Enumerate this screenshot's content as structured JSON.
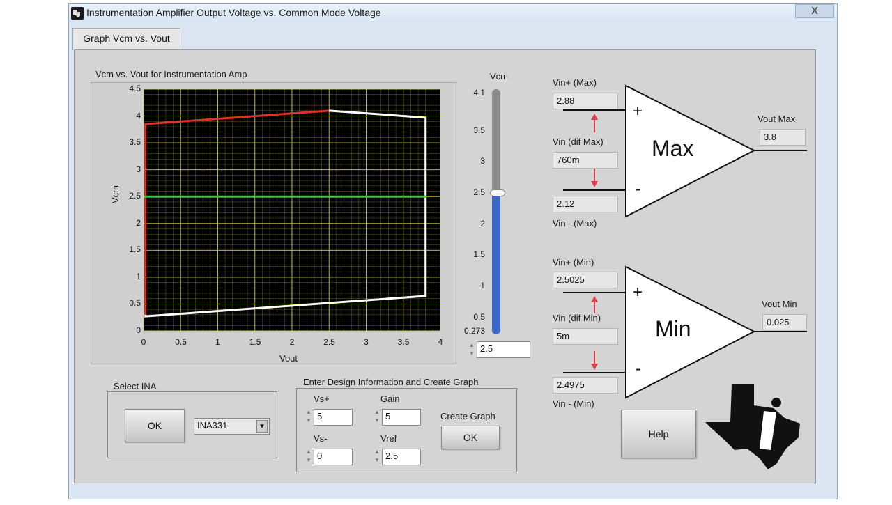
{
  "window": {
    "title": "Instrumentation Amplifier Output Voltage vs. Common Mode Voltage",
    "close_label": "X"
  },
  "tabs": [
    {
      "label": "Graph Vcm vs. Vout"
    }
  ],
  "graph": {
    "title": "Vcm vs. Vout for Instrumentation Amp",
    "xlabel": "Vout",
    "ylabel": "Vcm"
  },
  "chart_data": {
    "type": "line",
    "title": "Vcm vs. Vout for Instrumentation Amp",
    "xlabel": "Vout",
    "ylabel": "Vcm",
    "xlim": [
      0,
      4
    ],
    "ylim": [
      0,
      4.5
    ],
    "x_ticks": [
      "0",
      "0.5",
      "1",
      "1.5",
      "2",
      "2.5",
      "3",
      "3.5",
      "4"
    ],
    "y_ticks": [
      "0",
      "0.5",
      "1",
      "1.5",
      "2",
      "2.5",
      "3",
      "3.5",
      "4",
      "4.5"
    ],
    "grid": true,
    "series": [
      {
        "color": "#e03030",
        "x": [
          0.025,
          0.025,
          2.5
        ],
        "y": [
          0.3,
          3.85,
          4.1
        ]
      },
      {
        "color": "#ffffff",
        "x": [
          2.5,
          3.8,
          3.8,
          0.025,
          0.025
        ],
        "y": [
          4.1,
          3.97,
          0.65,
          0.27,
          0.3
        ]
      },
      {
        "color": "#3cc43c",
        "x": [
          0,
          3.8
        ],
        "y": [
          2.5,
          2.5
        ]
      }
    ]
  },
  "vcm_slider": {
    "label": "Vcm",
    "ticks": [
      "4.1",
      "3.5",
      "3",
      "2.5",
      "2",
      "1.5",
      "1",
      "0.5",
      "0.273"
    ],
    "value": 2.5,
    "min": 0.273,
    "max": 4.1,
    "input_value": "2.5",
    "fill_color": "#3a66c8"
  },
  "max_section": {
    "vin_plus_label": "Vin+ (Max)",
    "vin_plus_value": "2.88",
    "vin_dif_label": "Vin (dif Max)",
    "vin_dif_value": "760m",
    "vin_minus_label": "Vin - (Max)",
    "vin_minus_value": "2.12",
    "amp_label": "Max",
    "vout_label": "Vout Max",
    "vout_value": "3.8",
    "plus_sign": "+",
    "minus_sign": "-"
  },
  "min_section": {
    "vin_plus_label": "Vin+ (Min)",
    "vin_plus_value": "2.5025",
    "vin_dif_label": "Vin (dif Min)",
    "vin_dif_value": "5m",
    "vin_minus_label": "Vin - (Min)",
    "vin_minus_value": "2.4975",
    "amp_label": "Min",
    "vout_label": "Vout Min",
    "vout_value": "0.025",
    "plus_sign": "+",
    "minus_sign": "-"
  },
  "select_ina": {
    "label": "Select INA",
    "ok_label": "OK",
    "dropdown_value": "INA331",
    "dropdown_arrow": "▾"
  },
  "design": {
    "label": "Enter Design Information and Create Graph",
    "vs_plus_label": "Vs+",
    "vs_plus_value": "5",
    "gain_label": "Gain",
    "gain_value": "5",
    "vs_minus_label": "Vs-",
    "vs_minus_value": "0",
    "vref_label": "Vref",
    "vref_value": "2.5",
    "create_graph_label": "Create Graph",
    "create_ok_label": "OK"
  },
  "help_label": "Help",
  "colors": {
    "accent_red": "#e03030",
    "arrow_red": "#e0404a",
    "grid": "#b8b83a"
  }
}
